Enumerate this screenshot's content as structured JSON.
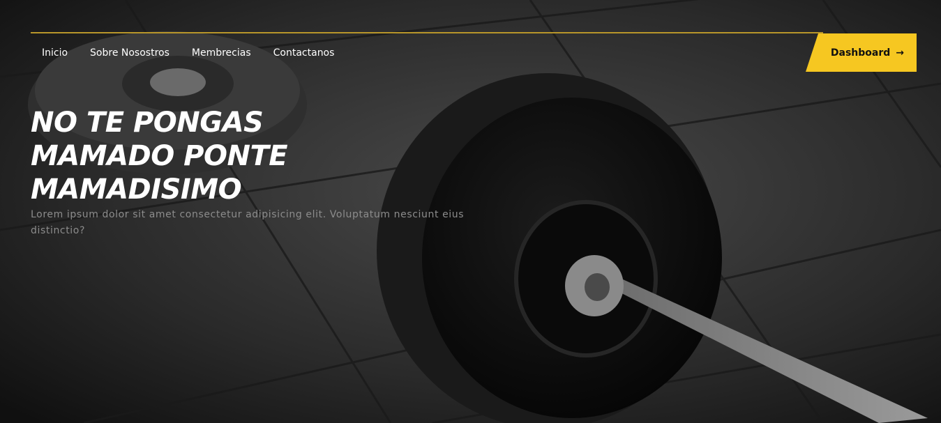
{
  "nav": {
    "items": [
      {
        "label": "Inicio"
      },
      {
        "label": "Sobre Nosostros"
      },
      {
        "label": "Membrecias"
      },
      {
        "label": "Contactanos"
      }
    ]
  },
  "header": {
    "dashboard_label": "Dashboard",
    "dashboard_icon": "arrow-right-icon",
    "accent_color": "#f6c721"
  },
  "hero": {
    "title": "NO TE PONGAS MAMADO PONTE MAMADISIMO",
    "subtitle": "Lorem ipsum dolor sit amet consectetur adipisicing elit. Voluptatum nesciunt eius distinctio?"
  }
}
